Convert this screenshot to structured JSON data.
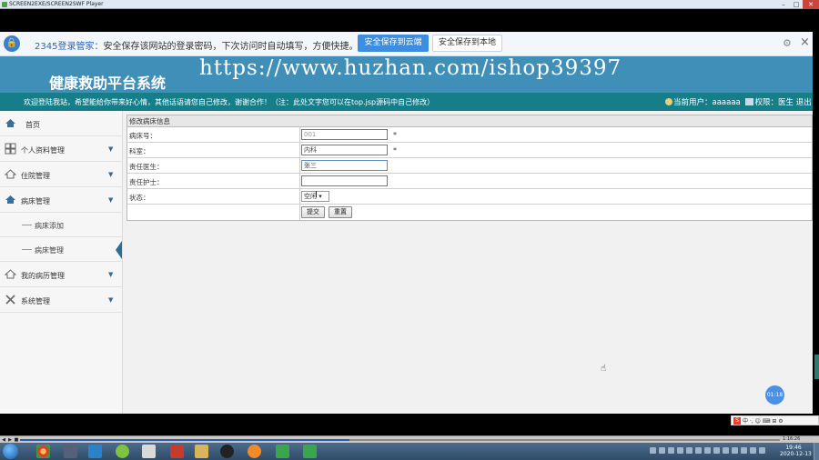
{
  "player": {
    "title": "SCREEN2EXE/SCREEN2SWF Player",
    "minimize": "–",
    "maximize": "□",
    "close": "✕",
    "controls": [
      "◀",
      "▶",
      "■"
    ],
    "time": "1:16:26"
  },
  "password_bar": {
    "brand": "2345登录管家：",
    "message": "安全保存该网站的登录密码，下次访问时自动填写，方便快捷。",
    "save_cloud": "安全保存到云端",
    "save_local": "安全保存到本地"
  },
  "header": {
    "site_title": "健康救助平台系统",
    "watermark": "https://www.huzhan.com/ishop39397"
  },
  "welcome": {
    "text": "欢迎登陆我站，希望能给你带来好心情，其他话语请您自己修改，谢谢合作！（注：此处文字您可以在top.jsp源码中自己修改）",
    "current_user": "当前用户：aaaaaa",
    "role": "权限：医生",
    "logout": "退出"
  },
  "sidebar": {
    "items": [
      {
        "label": "首页",
        "icon": "home-icon"
      },
      {
        "label": "个人资料管理",
        "icon": "grid-icon"
      },
      {
        "label": "住院管理",
        "icon": "house-icon"
      },
      {
        "label": "病床管理",
        "icon": "house-icon"
      }
    ],
    "sub_items": [
      {
        "label": "病床添加"
      },
      {
        "label": "病床管理"
      }
    ],
    "items_after": [
      {
        "label": "我的病历管理",
        "icon": "house-icon"
      },
      {
        "label": "系统管理",
        "icon": "tools-icon"
      }
    ]
  },
  "form": {
    "title": "修改病床信息",
    "fields": [
      {
        "label": "病床号：",
        "value": "001",
        "required": "*"
      },
      {
        "label": "科室：",
        "value": "内科",
        "required": "*"
      },
      {
        "label": "责任医生：",
        "value": "张三",
        "required": ""
      },
      {
        "label": "责任护士：",
        "value": "",
        "required": ""
      }
    ],
    "status_label": "状态：",
    "status_value": "空闲",
    "submit": "提交",
    "reset": "重置"
  },
  "timer": "01:18",
  "ime": {
    "logo": "S",
    "text": "中 ·, ☺ ⌨ ⊞ ⚙"
  },
  "taskbar": {
    "time": "19:46",
    "date": "2020-12-13"
  },
  "colors": {
    "header": "#3f8fb9",
    "welcome_bar": "#157e89",
    "cloud_button": "#3d8de0"
  }
}
